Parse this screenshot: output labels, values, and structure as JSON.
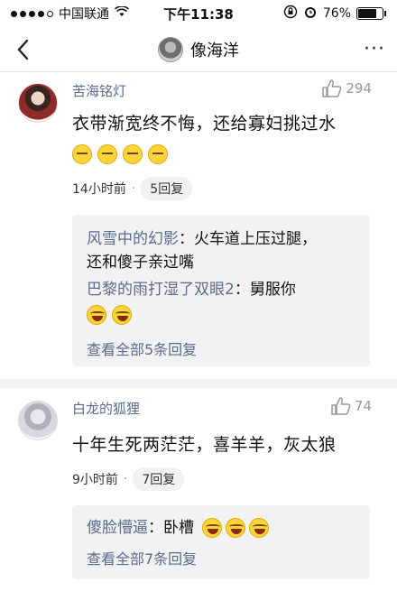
{
  "status_bar": {
    "carrier": "中国联通",
    "time": "下午11:38",
    "battery": "76%",
    "battery_level": 0.76,
    "signal_bars_filled": 4
  },
  "nav": {
    "title": "像海洋",
    "more": "···"
  },
  "comments": [
    {
      "username": "苦海铭灯",
      "likes": "294",
      "text": "衣带渐宽终不悔，还给寡妇挑过水",
      "emojis": [
        "sleepy",
        "sleepy",
        "sleepy",
        "sleepy"
      ],
      "time": "14小时前",
      "replies": "5回复",
      "reply_box": {
        "lines": [
          {
            "name": "风雪中的幻影",
            "sep": "：",
            "text": "火车道上压过腿，"
          },
          {
            "name": "",
            "sep": "",
            "text": "还和傻子亲过嘴"
          },
          {
            "name": "巴黎的雨打湿了双眼2",
            "sep": "：",
            "text": "舅服你"
          }
        ],
        "reply_emojis": [
          "laugh",
          "laugh"
        ],
        "view_all": "查看全部5条回复"
      }
    },
    {
      "username": "白龙的狐狸",
      "likes": "74",
      "text": "十年生死两茫茫，喜羊羊，灰太狼",
      "time": "9小时前",
      "replies": "7回复",
      "reply_box": {
        "lines": [
          {
            "name": "傻脸懵逼",
            "sep": "：",
            "text": "卧槽"
          }
        ],
        "reply_emojis": [
          "laugh",
          "laugh",
          "laugh"
        ],
        "view_all": "查看全部7条回复"
      }
    }
  ],
  "colors": {
    "username": "#5a6b8c",
    "reply_bg": "#f2f2f2",
    "emoji_yellow": "#ffd43b"
  }
}
